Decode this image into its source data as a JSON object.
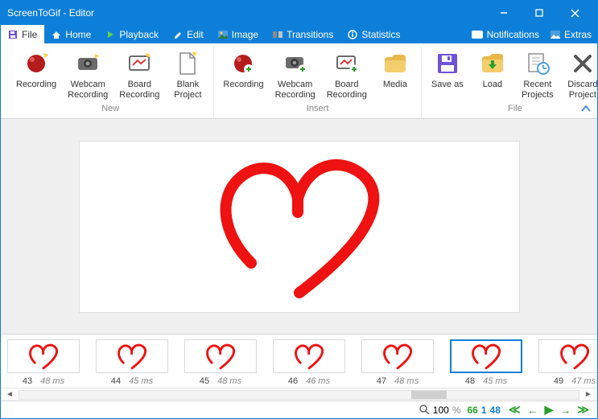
{
  "window": {
    "title": "ScreenToGif - Editor"
  },
  "menu": {
    "file": "File",
    "home": "Home",
    "playback": "Playback",
    "edit": "Edit",
    "image": "Image",
    "transitions": "Transitions",
    "statistics": "Statistics",
    "notifications": "Notifications",
    "extras": "Extras"
  },
  "ribbon": {
    "groups": {
      "new": "New",
      "insert": "Insert",
      "file": "File"
    },
    "new": {
      "recording": "Recording",
      "webcam": "Webcam\nRecording",
      "board": "Board\nRecording",
      "blank": "Blank\nProject"
    },
    "insert": {
      "recording": "Recording",
      "webcam": "Webcam\nRecording",
      "board": "Board\nRecording",
      "media": "Media"
    },
    "file": {
      "saveas": "Save as",
      "load": "Load",
      "recent": "Recent\nProjects",
      "discard": "Discard\nProject"
    }
  },
  "frames": [
    {
      "n": "43",
      "ms": "48 ms"
    },
    {
      "n": "44",
      "ms": "45 ms"
    },
    {
      "n": "45",
      "ms": "48 ms"
    },
    {
      "n": "46",
      "ms": "46 ms"
    },
    {
      "n": "47",
      "ms": "48 ms"
    },
    {
      "n": "48",
      "ms": "45 ms",
      "sel": true
    },
    {
      "n": "49",
      "ms": "47 ms"
    }
  ],
  "status": {
    "zoom": "100",
    "pct": "%",
    "total": "66",
    "sel": "1",
    "cur": "48"
  }
}
